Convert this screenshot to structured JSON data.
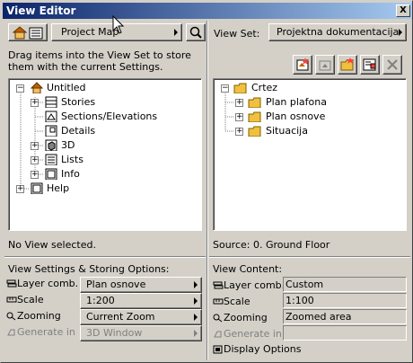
{
  "window": {
    "title": "View Editor",
    "close_label": "X"
  },
  "left": {
    "map_selector": "Project Map",
    "instructions": "Drag items into the View Set to store them with the current Settings.",
    "tree": [
      {
        "label": "Untitled",
        "icon": "house-icon",
        "expander": "−"
      },
      {
        "label": "Stories",
        "icon": "stories-icon",
        "expander": "+"
      },
      {
        "label": "Sections/Elevations",
        "icon": "section-icon",
        "expander": ""
      },
      {
        "label": "Details",
        "icon": "details-icon",
        "expander": ""
      },
      {
        "label": "3D",
        "icon": "3d-icon",
        "expander": "+"
      },
      {
        "label": "Lists",
        "icon": "lists-icon",
        "expander": "+"
      },
      {
        "label": "Info",
        "icon": "info-icon",
        "expander": "+"
      },
      {
        "label": "Help",
        "icon": "help-icon",
        "expander": "+"
      }
    ],
    "status": "No View selected.",
    "settings_title": "View Settings & Storing Options:",
    "settings": [
      {
        "label": "Layer comb.",
        "value": "Plan osnove",
        "icon": "layers-icon",
        "disabled": false
      },
      {
        "label": "Scale",
        "value": "1:200",
        "icon": "scale-icon",
        "disabled": false
      },
      {
        "label": "Zooming",
        "value": "Current Zoom",
        "icon": "zoom-icon",
        "disabled": false
      },
      {
        "label": "Generate in",
        "value": "3D Window",
        "icon": "generate-icon",
        "disabled": true
      }
    ]
  },
  "right": {
    "viewset_label": "View Set:",
    "viewset_value": "Projektna dokumentacija",
    "tree": [
      {
        "label": "Crtez",
        "expander": "−"
      },
      {
        "label": "Plan plafona",
        "expander": "+"
      },
      {
        "label": "Plan osnove",
        "expander": "+"
      },
      {
        "label": "Situacija",
        "expander": "+"
      }
    ],
    "source": "Source: 0. Ground Floor",
    "content_title": "View Content:",
    "content": [
      {
        "label": "Layer comb.",
        "value": "Custom",
        "icon": "layers-icon",
        "disabled": false
      },
      {
        "label": "Scale",
        "value": "1:100",
        "icon": "scale-icon",
        "disabled": false
      },
      {
        "label": "Zooming",
        "value": "Zoomed area",
        "icon": "zoom-icon",
        "disabled": false
      },
      {
        "label": "Generate in",
        "value": "",
        "icon": "generate-icon",
        "disabled": true
      }
    ],
    "display_options": "Display Options"
  }
}
